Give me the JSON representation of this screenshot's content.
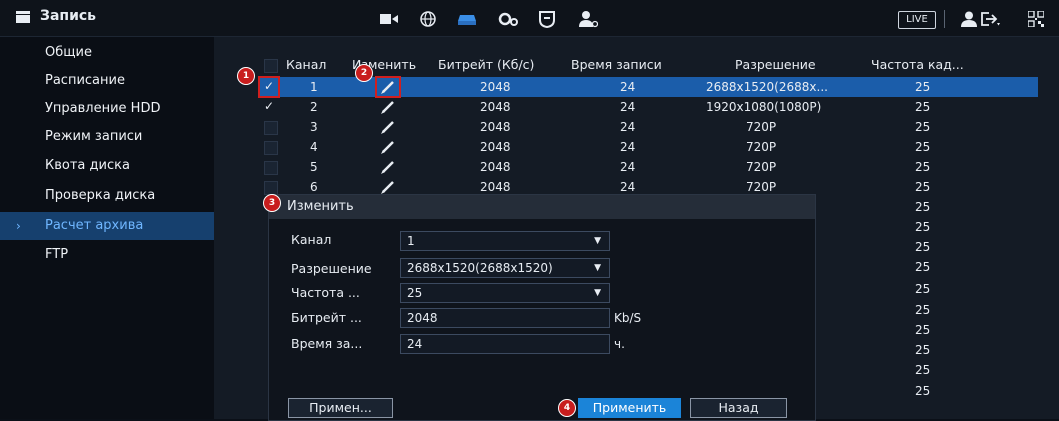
{
  "header": {
    "title": "Запись",
    "live_label": "LIVE",
    "icons": [
      "record-icon",
      "network-icon",
      "storage-icon",
      "settings-icon",
      "security-icon",
      "account-icon",
      "user-icon",
      "logout-icon",
      "qr-icon"
    ]
  },
  "sidebar": {
    "items": [
      {
        "label": "Общие",
        "active": false
      },
      {
        "label": "Расписание",
        "active": false
      },
      {
        "label": "Управление HDD",
        "active": false
      },
      {
        "label": "Режим записи",
        "active": false
      },
      {
        "label": "Квота диска",
        "active": false
      },
      {
        "label": "Проверка диска",
        "active": false
      },
      {
        "label": "Расчет архива",
        "active": true
      },
      {
        "label": "FTP",
        "active": false
      }
    ]
  },
  "table": {
    "columns": [
      "Канал",
      "Изменить",
      "Битрейт (Кб/с)",
      "Время записи",
      "Разрешение",
      "Частота кад..."
    ],
    "rows": [
      {
        "ch": "1",
        "bitrate": "2048",
        "time": "24",
        "res": "2688x1520(2688x...",
        "fps": "25",
        "checked": true,
        "selected": true
      },
      {
        "ch": "2",
        "bitrate": "2048",
        "time": "24",
        "res": "1920x1080(1080P)",
        "fps": "25",
        "checked": true,
        "selected": false
      },
      {
        "ch": "3",
        "bitrate": "2048",
        "time": "24",
        "res": "720P",
        "fps": "25",
        "checked": false,
        "selected": false
      },
      {
        "ch": "4",
        "bitrate": "2048",
        "time": "24",
        "res": "720P",
        "fps": "25",
        "checked": false,
        "selected": false
      },
      {
        "ch": "5",
        "bitrate": "2048",
        "time": "24",
        "res": "720P",
        "fps": "25",
        "checked": false,
        "selected": false
      },
      {
        "ch": "6",
        "bitrate": "2048",
        "time": "24",
        "res": "720P",
        "fps": "25",
        "checked": false,
        "selected": false
      }
    ],
    "extra_fps": [
      "25",
      "25",
      "25",
      "25",
      "25",
      "25",
      "25",
      "25",
      "25",
      "25"
    ]
  },
  "dialog": {
    "title": "Изменить",
    "channel_label": "Канал",
    "channel_value": "1",
    "resolution_label": "Разрешение",
    "resolution_value": "2688x1520(2688x1520)",
    "fps_label": "Частота ...",
    "fps_value": "25",
    "bitrate_label": "Битрейт ...",
    "bitrate_value": "2048",
    "bitrate_unit": "Kb/S",
    "time_label": "Время за...",
    "time_value": "24",
    "time_unit": "ч."
  },
  "footer": {
    "apply_all_label": "Примен...",
    "apply_label": "Применить",
    "back_label": "Назад"
  },
  "markers": [
    "1",
    "2",
    "3",
    "4"
  ],
  "colors": {
    "accent": "#1b84d8",
    "selected_row": "#1b5daa",
    "marker": "#c81d1d",
    "active_side": "#16406e"
  }
}
